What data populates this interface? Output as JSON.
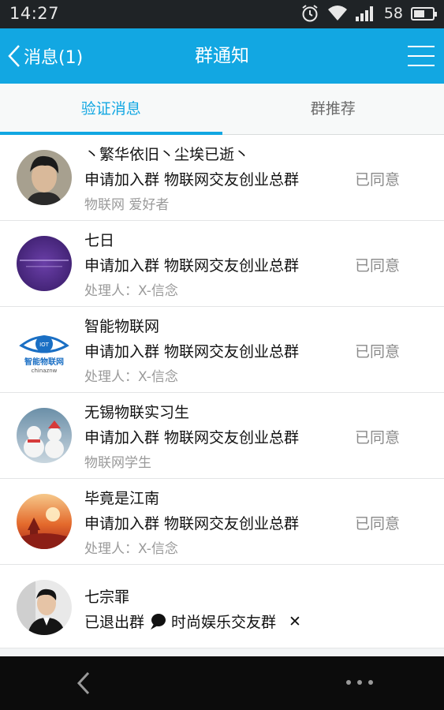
{
  "status_bar": {
    "time": "14:27",
    "battery": "58",
    "battery_level": 0.58
  },
  "header": {
    "back_label": "消息(1)",
    "title": "群通知"
  },
  "tabs": [
    {
      "label": "验证消息",
      "active": true
    },
    {
      "label": "群推荐",
      "active": false
    }
  ],
  "notices": [
    {
      "name": "丶繁华依旧丶尘埃已逝丶",
      "action": "申请加入群 物联网交友创业总群",
      "status": "已同意",
      "note": "物联网 爱好者"
    },
    {
      "name": "七日",
      "action": "申请加入群 物联网交友创业总群",
      "status": "已同意",
      "note": "处理人：X-信念"
    },
    {
      "name": "智能物联网",
      "action": "申请加入群 物联网交友创业总群",
      "status": "已同意",
      "note": "处理人：X-信念"
    },
    {
      "name": "无锡物联实习生",
      "action": "申请加入群 物联网交友创业总群",
      "status": "已同意",
      "note": "物联网学生"
    },
    {
      "name": " 毕竟是江南",
      "action": "申请加入群 物联网交友创业总群",
      "status": "已同意",
      "note": "处理人：X-信念"
    },
    {
      "name": "七宗罪",
      "action": "已退出群",
      "group": "时尚娱乐交友群",
      "close": "✕"
    }
  ],
  "avatar_texts": {
    "iot_badge": "IOT",
    "iot_name": "智能物联网",
    "iot_domain": "chinaznw"
  },
  "colors": {
    "accent": "#12a7e2",
    "status_bar": "#1f2326",
    "nav_bar": "#0c0c0c"
  }
}
